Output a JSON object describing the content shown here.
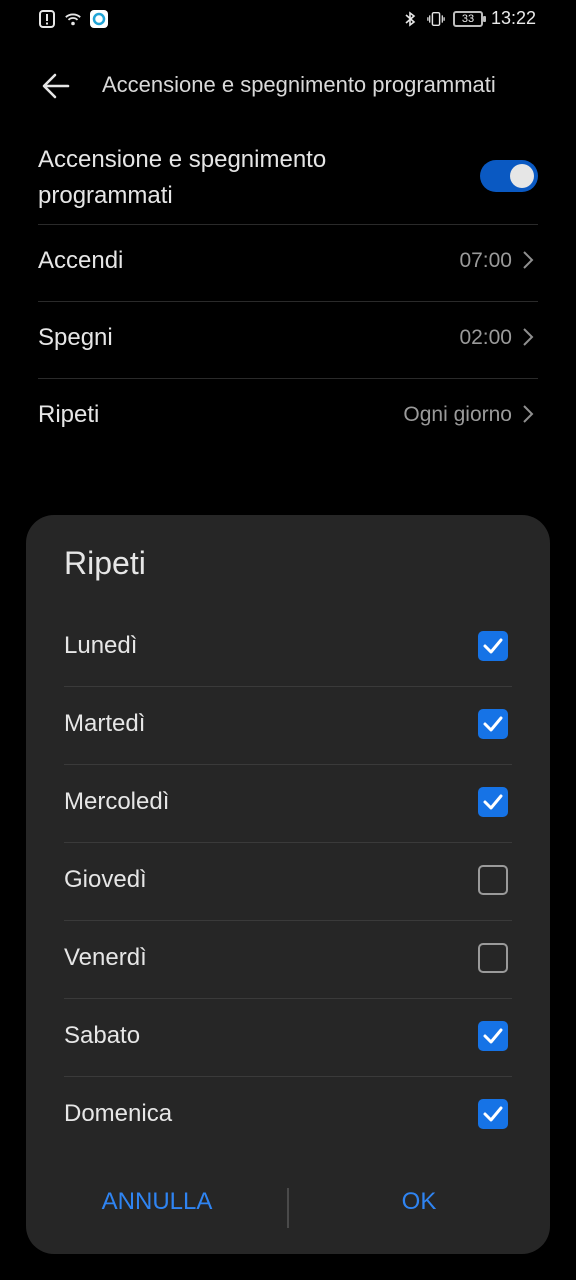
{
  "status": {
    "time": "13:22",
    "battery": "33",
    "left_icons": [
      "alert-icon",
      "wifi-icon",
      "app-icon"
    ],
    "right_icons": [
      "bluetooth-icon",
      "vibrate-icon",
      "battery-icon"
    ]
  },
  "header": {
    "title": "Accensione e spegnimento programmati"
  },
  "settings": {
    "master_label": "Accensione e spegnimento programmati",
    "master_enabled": true,
    "accendi": {
      "label": "Accendi",
      "value": "07:00"
    },
    "spegni": {
      "label": "Spegni",
      "value": "02:00"
    },
    "ripeti": {
      "label": "Ripeti",
      "value": "Ogni giorno"
    }
  },
  "dialog": {
    "title": "Ripeti",
    "options": [
      {
        "label": "Lunedì",
        "checked": true
      },
      {
        "label": "Martedì",
        "checked": true
      },
      {
        "label": "Mercoledì",
        "checked": true
      },
      {
        "label": "Giovedì",
        "checked": false
      },
      {
        "label": "Venerdì",
        "checked": false
      },
      {
        "label": "Sabato",
        "checked": true
      },
      {
        "label": "Domenica",
        "checked": true
      }
    ],
    "cancel": "ANNULLA",
    "ok": "OK"
  },
  "colors": {
    "accent": "#1673e6",
    "toggle_on": "#0a59c2",
    "dialog_bg": "#262626"
  }
}
